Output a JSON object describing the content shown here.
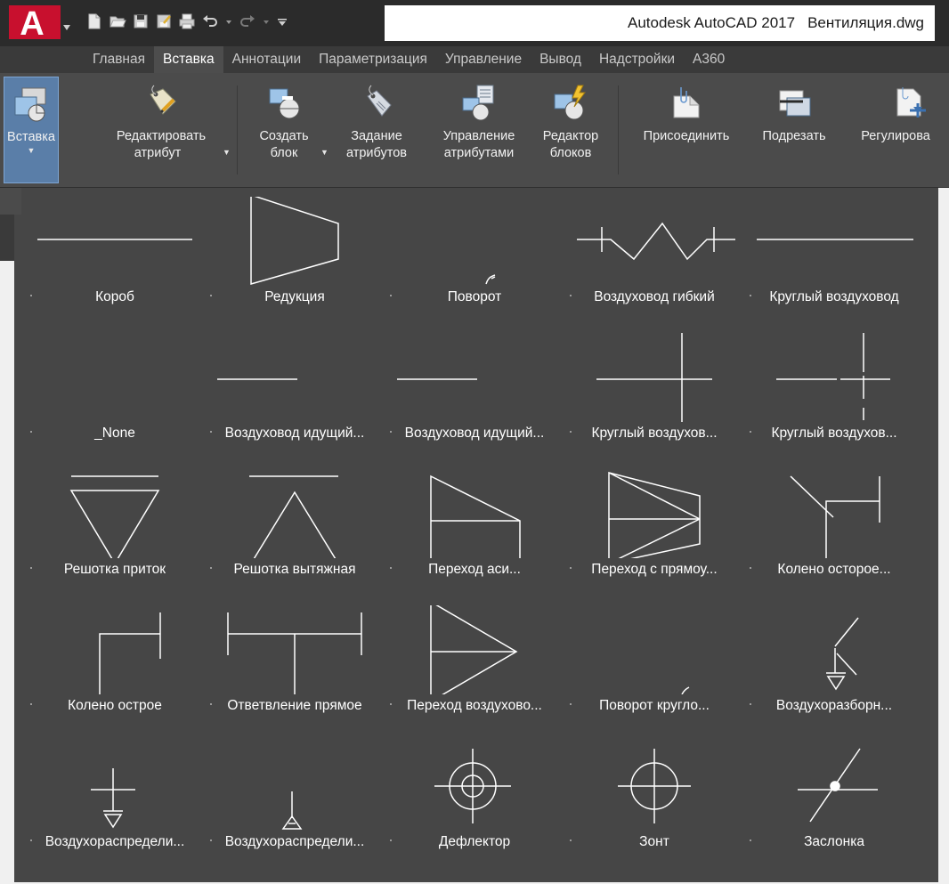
{
  "colors": {
    "accent_red": "#c8102e",
    "palette_bg": "#464646",
    "ribbon_bg": "#4b4b4b",
    "active_button": "#5a7ea8"
  },
  "titlebar": {
    "app_title": "Autodesk AutoCAD 2017",
    "file_name": "Вентиляция.dwg",
    "logo_letter": "A"
  },
  "quick_access": [
    {
      "icon": "new-file-icon"
    },
    {
      "icon": "open-folder-icon"
    },
    {
      "icon": "save-icon"
    },
    {
      "icon": "save-as-icon"
    },
    {
      "icon": "print-icon"
    },
    {
      "icon": "undo-icon"
    },
    {
      "icon": "redo-icon"
    },
    {
      "icon": "customize-dropdown-icon"
    }
  ],
  "tabs": [
    {
      "label": "Главная",
      "active": false
    },
    {
      "label": "Вставка",
      "active": true
    },
    {
      "label": "Аннотации",
      "active": false
    },
    {
      "label": "Параметризация",
      "active": false
    },
    {
      "label": "Управление",
      "active": false
    },
    {
      "label": "Вывод",
      "active": false
    },
    {
      "label": "Надстройки",
      "active": false
    },
    {
      "label": "A360",
      "active": false
    }
  ],
  "ribbon": {
    "insert": {
      "line1": "Вставка",
      "icon": "insert-block-icon"
    },
    "edit_attr": {
      "line1": "Редактировать",
      "line2": "атрибут",
      "icon": "edit-attribute-icon"
    },
    "create_block": {
      "line1": "Создать",
      "line2": "блок",
      "icon": "create-block-icon"
    },
    "define_attr": {
      "line1": "Задание",
      "line2": "атрибутов",
      "icon": "define-attributes-icon"
    },
    "manage_attr": {
      "line1": "Управление",
      "line2": "атрибутами",
      "icon": "manage-attributes-icon"
    },
    "block_editor": {
      "line1": "Редактор",
      "line2": "блоков",
      "icon": "block-editor-icon"
    },
    "attach": {
      "line1": "Присоединить",
      "icon": "attach-icon"
    },
    "clip": {
      "line1": "Подрезать",
      "icon": "clip-icon"
    },
    "adjust": {
      "line1": "Регулирова",
      "icon": "adjust-icon"
    }
  },
  "blocks": [
    {
      "label": "Короб",
      "icon": "duct-line-icon"
    },
    {
      "label": "Редукция",
      "icon": "reducer-icon"
    },
    {
      "label": "Поворот",
      "icon": "turn-icon"
    },
    {
      "label": "Воздуховод гибкий",
      "icon": "flexible-duct-icon"
    },
    {
      "label": "Круглый воздуховод",
      "icon": "round-duct-icon"
    },
    {
      "label": "_None",
      "icon": "none-icon"
    },
    {
      "label": "Воздуховод идущий...",
      "icon": "duct-going-line-icon"
    },
    {
      "label": "Воздуховод идущий...",
      "icon": "duct-going-line-icon"
    },
    {
      "label": "Круглый воздухов...",
      "icon": "round-duct-cross-icon"
    },
    {
      "label": "Круглый воздухов...",
      "icon": "round-duct-cross-broken-icon"
    },
    {
      "label": "Решотка приток",
      "icon": "supply-grille-icon"
    },
    {
      "label": "Решотка вытяжная",
      "icon": "exhaust-grille-icon"
    },
    {
      "label": "Переход аси...",
      "icon": "asymmetric-transition-icon"
    },
    {
      "label": "Переход с прямоу...",
      "icon": "rect-transition-icon"
    },
    {
      "label": "Колено осторое...",
      "icon": "sharp-elbow-diagonal-icon"
    },
    {
      "label": "Колено острое",
      "icon": "sharp-elbow-icon"
    },
    {
      "label": "Ответвление прямое",
      "icon": "straight-branch-icon"
    },
    {
      "label": "Переход воздухово...",
      "icon": "duct-transition-icon"
    },
    {
      "label": "Поворот кругло...",
      "icon": "round-turn-icon"
    },
    {
      "label": "Воздухоразборн...",
      "icon": "air-intake-icon"
    },
    {
      "label": "Воздухораспредели...",
      "icon": "air-distributor-icon"
    },
    {
      "label": "Воздухораспредели...",
      "icon": "air-distributor-triangle-icon"
    },
    {
      "label": "Дефлектор",
      "icon": "deflector-icon"
    },
    {
      "label": "Зонт",
      "icon": "umbrella-icon"
    },
    {
      "label": "Заслонка",
      "icon": "damper-icon"
    }
  ]
}
